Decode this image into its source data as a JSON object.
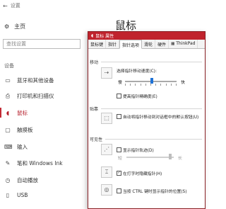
{
  "settings": {
    "title": "设置",
    "home": "主页",
    "search_placeholder": "查找设置",
    "group": "设备",
    "page_title": "鼠标",
    "nav": [
      {
        "label": "蓝牙和其他设备",
        "icon": "bluetooth-icon"
      },
      {
        "label": "打印机和扫描仪",
        "icon": "printer-icon"
      },
      {
        "label": "鼠标",
        "icon": "mouse-icon"
      },
      {
        "label": "触摸板",
        "icon": "touchpad-icon"
      },
      {
        "label": "输入",
        "icon": "keyboard-icon"
      },
      {
        "label": "笔和 Windows Ink",
        "icon": "pen-icon"
      },
      {
        "label": "自动播放",
        "icon": "autoplay-icon"
      },
      {
        "label": "USB",
        "icon": "usb-icon"
      }
    ]
  },
  "dialog": {
    "title": "鼠标 属性",
    "tabs": [
      "鼠标键",
      "指针",
      "指针选项",
      "滑轮",
      "硬件",
      "ThinkPad"
    ],
    "motion": {
      "heading": "移动",
      "speed_label": "选择指针移动速度(C):",
      "slow": "慢",
      "fast": "快",
      "precision_label": "提高指针精确度(E)"
    },
    "snap": {
      "heading": "贴靠",
      "label": "自动将指针移动到对话框中的默认按钮(U)"
    },
    "visibility": {
      "heading": "可见性",
      "trails_label": "显示指针轨迹(D)",
      "short": "短",
      "long": "长",
      "hide_label": "在打字时隐藏指针(H)",
      "ctrl_label": "当按 CTRL 键时显示指针的位置(S)"
    }
  },
  "colors": {
    "accent": "#c0232d"
  }
}
